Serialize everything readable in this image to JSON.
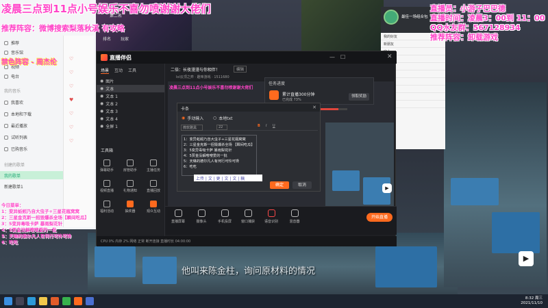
{
  "overlay": {
    "top_title": "凌晨三点到11点小号娱乐不喜勿喷谢谢大佬们",
    "recommend_left": "推荐阵容：微博搜索梨落秋溪 有攻略",
    "banned": "禁色阵容 - 周杰伦",
    "streamer": "直播员：小游子巴巴德",
    "stream_time": "直播时间：凌晨3：00到 11：00",
    "qq_group": "QQ水友群：567128934",
    "recommend_right": "推荐阵容：卸载游戏",
    "menu_title": "今日菜单：",
    "menu_items": [
      "1：变异蚯蚓乃自大虫子+三星花瓶窝窝",
      "2：三星金克斯一招毁爆杀全场【瞬间吃瓜】",
      "3：5变异毒吸卡萨 暴雨梨花针",
      "4：5贾金没解嗖嗖爱的一批",
      "5：天琳的德尔凡人有何行可怜可馋",
      "6：吃吃"
    ]
  },
  "music_app": {
    "items": [
      "推荐",
      "音乐馆",
      "视频",
      "电台",
      "我的音乐",
      "我喜欢",
      "本地和下载",
      "最近播放",
      "试听列表",
      "已购音乐",
      "创建的歌单",
      "我的歌单",
      "新建歌单1"
    ],
    "side_labels": [
      "排名",
      "玩家",
      "第七名",
      "第二名"
    ]
  },
  "app": {
    "logo": "直播伴侣",
    "tabs": [
      "场景",
      "互动",
      "工具"
    ],
    "stream_title": "二倍：长夜漫漫与你相伴！",
    "title_edit": "编辑",
    "meta": "lol云顶之弈 · 趣味游戏 · 1511680",
    "layers": [
      "图片",
      "文本",
      "文本 1",
      "文本 2",
      "文本 3",
      "文本 4",
      "全屏 1"
    ],
    "toolbox_title": "工具箱",
    "tools": [
      "弹幕助手",
      "房管助手",
      "主播任务",
      "视频直播",
      "礼物通知",
      "直播回放",
      "福利活动",
      "抽奖器",
      "观众互动"
    ],
    "bottom_buttons": [
      "直播屏幕",
      "摄像头",
      "手机投屏",
      "窗口捕获",
      "语音识别",
      "混音器"
    ],
    "go_live": "开始直播",
    "status": "CPU 0% 内存 2% 网络 正常 断开连接 直播时长 04:00:00"
  },
  "notify": {
    "title": "任务进度",
    "name": "累计直播300分钟",
    "sub": "已完成 73%",
    "button": "领取奖励",
    "progress": 0.73
  },
  "dialog": {
    "title": "卡条",
    "radio1": "手动输入",
    "radio2": "本地txt",
    "font": "微软雅黑",
    "size": "22",
    "lines": [
      "1：变异蚯蚓乃自大虫子+三星花瓶窝窝",
      "2：三星金克斯一招毁爆杀全场 【瞬间吃瓜】",
      "3：5变异毒吸卡萨 暴雨梨花针",
      "4：5贾金没解嗖嗖爱的一批",
      "5：天琳的德尔凡人有何行可怜可馋",
      "6：吃吃"
    ],
    "input_hint": "上传 | 文 | 更 | 文 | 文 | 稿",
    "confirm": "确定",
    "cancel": "取消"
  },
  "chat": {
    "header": "最佳一场组合包",
    "rows": [
      "我的好友",
      "新朋友",
      "家人",
      "同学",
      "电竞群",
      "游戏",
      "主播群",
      "水友群",
      "工作群",
      "其他"
    ],
    "count": "594019"
  },
  "video": {
    "subtitle": "他叫来陈金柱，询问原材料的情况"
  },
  "taskbar": {
    "time": "8:32 周三",
    "date": "2021/11/10"
  },
  "colors": {
    "accent": "#ff6a1e",
    "overlay_pink": "#ff44c8"
  }
}
